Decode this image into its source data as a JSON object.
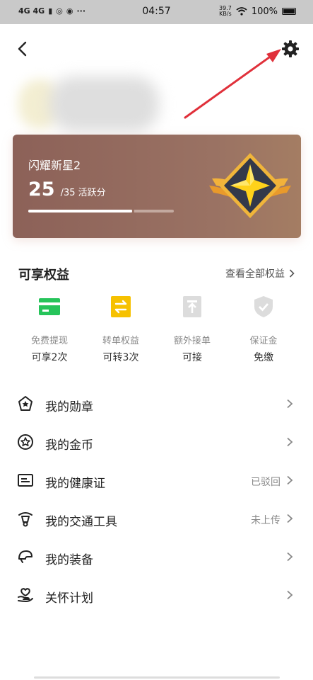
{
  "status_bar": {
    "network": "4G 4G",
    "time": "04:57",
    "speed_value": "39.7",
    "speed_unit": "KB/s",
    "battery": "100%"
  },
  "level_card": {
    "title": "闪耀新星2",
    "score": "25",
    "score_total": "/35 活跃分",
    "progress_fraction": 0.714
  },
  "benefits": {
    "title": "可享权益",
    "view_all": "查看全部权益",
    "items": [
      {
        "label": "免费提现",
        "value": "可享2次",
        "icon": "card-icon",
        "color": "#26c45a"
      },
      {
        "label": "转单权益",
        "value": "可转3次",
        "icon": "transfer-icon",
        "color": "#f6c100"
      },
      {
        "label": "额外接单",
        "value": "可接",
        "icon": "upload-icon",
        "color": "#dcdcdc"
      },
      {
        "label": "保证金",
        "value": "免缴",
        "icon": "shield-check-icon",
        "color": "#dcdcdc"
      }
    ]
  },
  "menu": {
    "items": [
      {
        "label": "我的勋章",
        "status": "",
        "icon": "medal-icon"
      },
      {
        "label": "我的金币",
        "status": "",
        "icon": "coin-star-icon"
      },
      {
        "label": "我的健康证",
        "status": "已驳回",
        "icon": "id-card-icon"
      },
      {
        "label": "我的交通工具",
        "status": "未上传",
        "icon": "scooter-icon"
      },
      {
        "label": "我的装备",
        "status": "",
        "icon": "helmet-icon"
      },
      {
        "label": "关怀计划",
        "status": "",
        "icon": "care-heart-icon"
      }
    ]
  },
  "colors": {
    "card_start": "#8c6158",
    "card_end": "#a47d63",
    "annotation_arrow": "#e0303a"
  }
}
